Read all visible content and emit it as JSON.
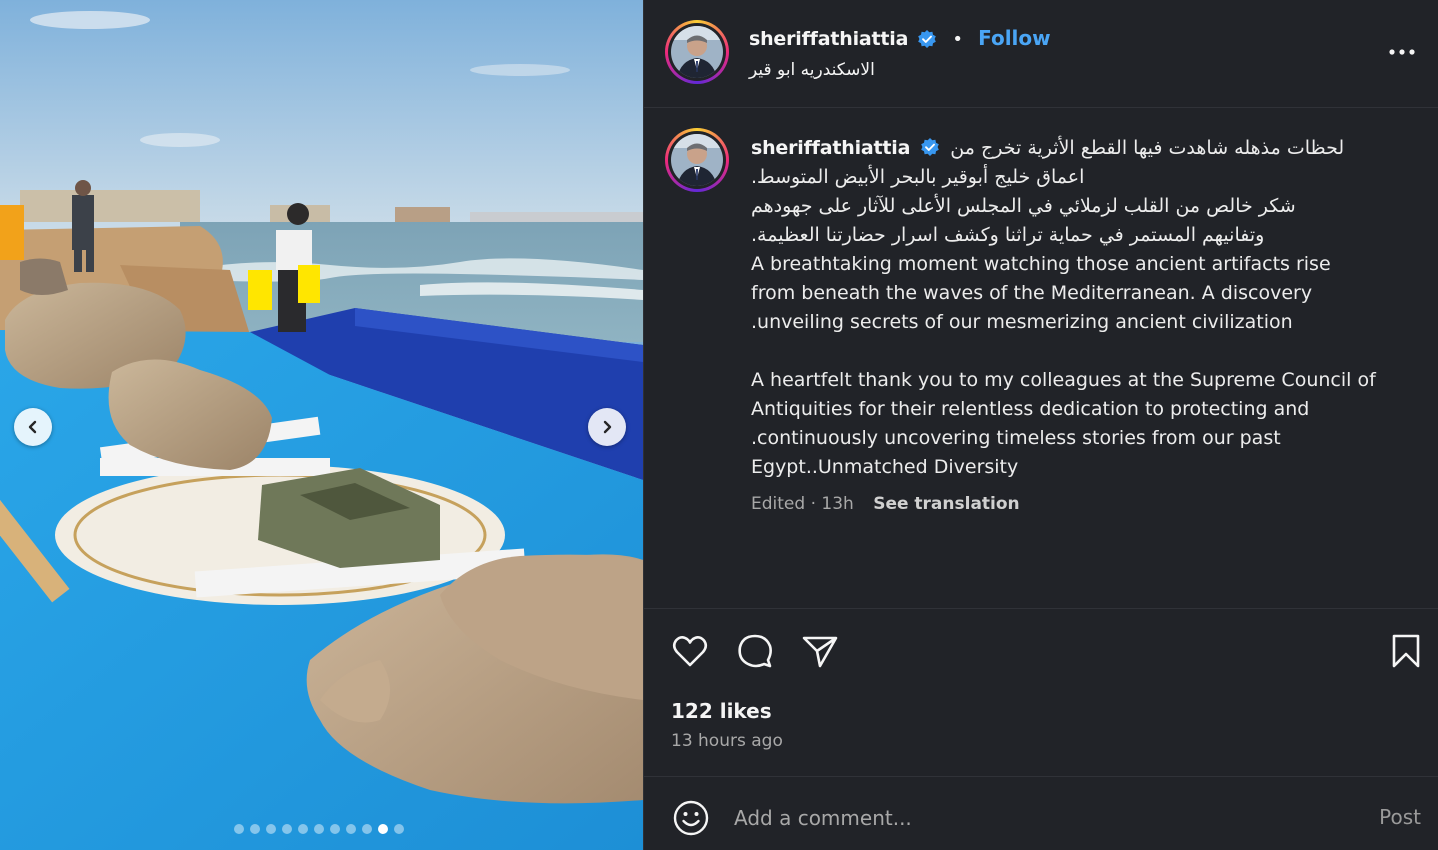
{
  "media": {
    "carousel": {
      "total_slides": 11,
      "active_index": 9
    },
    "prev_icon": "chevron-left-icon",
    "next_icon": "chevron-right-icon"
  },
  "post_header": {
    "username": "sheriffathiattia",
    "verified": true,
    "separator": "•",
    "follow_label": "Follow",
    "location": "الاسكندريه ابو قير",
    "more_icon": "more-horizontal-icon"
  },
  "caption": {
    "username": "sheriffathiattia",
    "lines": [
      "لحظات مذهله شاهدت فيها القطع الأثرية تخرج من",
      "اعماق خليج أبوقير بالبحر الأبيض المتوسط.",
      "شكر خالص من القلب لزملائي في المجلس الأعلى للآثار على جهودهم",
      "وتفانيهم المستمر في حماية تراثنا وكشف اسرار حضارتنا العظيمة.",
      "A breathtaking moment watching those ancient artifacts rise",
      "from beneath the waves of the Mediterranean. A discovery",
      ".unveiling secrets of our mesmerizing ancient civilization",
      "",
      "A heartfelt thank you to my colleagues at the Supreme Council of",
      "Antiquities for their relentless dedication to protecting and",
      ".continuously uncovering timeless stories from our past",
      "Egypt..Unmatched Diversity"
    ],
    "edited_meta": "Edited · 13h",
    "see_translation": "See translation"
  },
  "actions": {
    "like_icon": "heart-icon",
    "comment_icon": "comment-icon",
    "share_icon": "send-icon",
    "save_icon": "bookmark-icon",
    "likes": "122 likes",
    "time_ago": "13 hours ago"
  },
  "comment": {
    "emoji_icon": "emoji-icon",
    "placeholder": "Add a comment...",
    "post_label": "Post"
  },
  "colors": {
    "panel_bg": "#212328",
    "follow_blue": "#4aa5f5",
    "verified_blue": "#3897f0",
    "muted_text": "#a8a8a8"
  }
}
